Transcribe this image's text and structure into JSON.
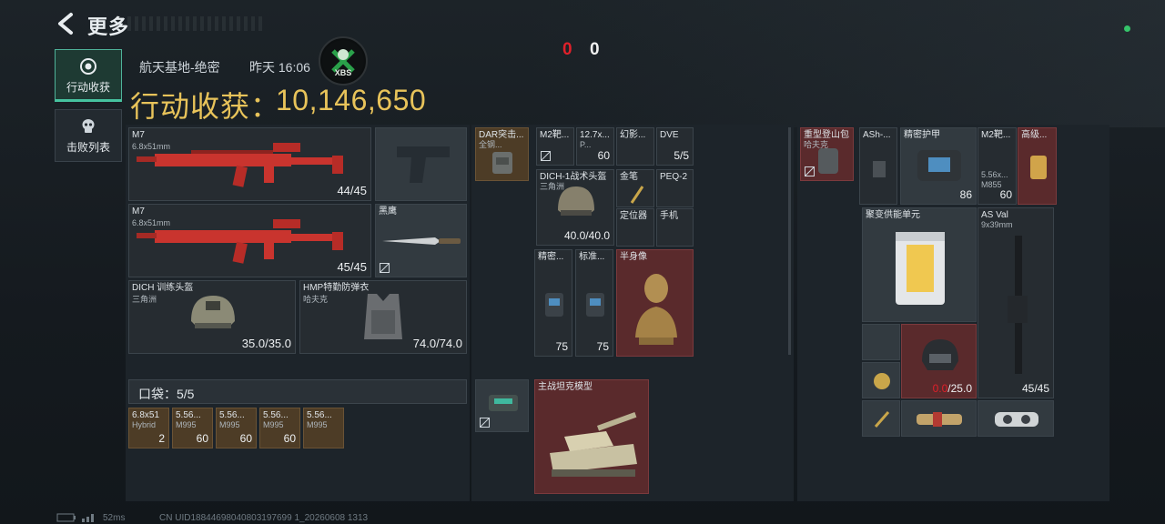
{
  "header": {
    "title": "更多"
  },
  "sidebar": {
    "tabs": [
      {
        "label": "行动收获",
        "icon": "loot-icon",
        "active": true
      },
      {
        "label": "击败列表",
        "icon": "skull-icon",
        "active": false
      }
    ]
  },
  "match": {
    "map": "航天基地-绝密",
    "time": "昨天 16:06",
    "avatar_text": "XBS"
  },
  "score": {
    "red": "0",
    "white": "0"
  },
  "loot": {
    "label": "行动收获：",
    "value": "10,146,650"
  },
  "loadout": {
    "primary1": {
      "name": "M7",
      "ammo": "6.8x51mm",
      "count": "44/45"
    },
    "primary2": {
      "name": "M7",
      "ammo": "6.8x51mm",
      "count": "45/45"
    },
    "melee": {
      "name": "黑鹰"
    },
    "helmet": {
      "name": "DICH 训练头盔",
      "sub": "三角洲",
      "durability": "35.0/35.0"
    },
    "armor": {
      "name": "HMP特勤防弹衣",
      "sub": "哈夫克",
      "durability": "74.0/74.0"
    }
  },
  "pocket": {
    "label": "口袋：5/5",
    "items": [
      {
        "name": "6.8x51",
        "sub": "Hybrid",
        "count": "2"
      },
      {
        "name": "5.56...",
        "sub": "M995",
        "count": "60"
      },
      {
        "name": "5.56...",
        "sub": "M995",
        "count": "60"
      },
      {
        "name": "5.56...",
        "sub": "M995",
        "count": "60"
      },
      {
        "name": "5.56...",
        "sub": "M995",
        "count": ""
      }
    ]
  },
  "rig": {
    "dar": {
      "name": "DAR突击...",
      "sub": "全钢..."
    },
    "m2": {
      "name": "M2靶...",
      "count": ""
    },
    "ammo127": {
      "name": "12.7x...",
      "sub": "P...",
      "count": "60"
    },
    "phantom": {
      "name": "幻影..."
    },
    "dve": {
      "name": "DVE",
      "count": "5/5"
    },
    "dich1": {
      "name": "DICH-1战术头盔",
      "sub": "三角洲",
      "durability": "40.0/40.0"
    },
    "goldfeather": {
      "name": "金笔"
    },
    "peq": {
      "name": "PEQ-2"
    },
    "locator": {
      "name": "定位器"
    },
    "phone": {
      "name": "手机"
    },
    "precision": {
      "name": "精密...",
      "count": "75"
    },
    "standard": {
      "name": "标准...",
      "count": "75"
    },
    "bust": {
      "name": "半身像"
    },
    "device": {
      "name": ""
    },
    "tank": {
      "name": "主战坦克模型"
    }
  },
  "backpack": {
    "heavy": {
      "name": "重型登山包",
      "sub": "哈夫克"
    },
    "ash": {
      "name": "ASh-..."
    },
    "armor_precise": {
      "name": "精密护甲",
      "count": "86"
    },
    "m2b": {
      "name": "M2靶...",
      "sub": "5.56x...",
      "sub2": "M855",
      "count": "60"
    },
    "advanced": {
      "name": "高级..."
    },
    "fusion": {
      "name": "聚变供能单元"
    },
    "asval": {
      "name": "AS Val",
      "sub": "9x39mm",
      "count": "45/45"
    },
    "helmet2": {
      "name": "",
      "durability_red": "0.0",
      "durability": "/25.0"
    }
  },
  "footer": {
    "ping": "52ms",
    "uid": "CN UID18844698040803197699 1_20260608 1313"
  }
}
